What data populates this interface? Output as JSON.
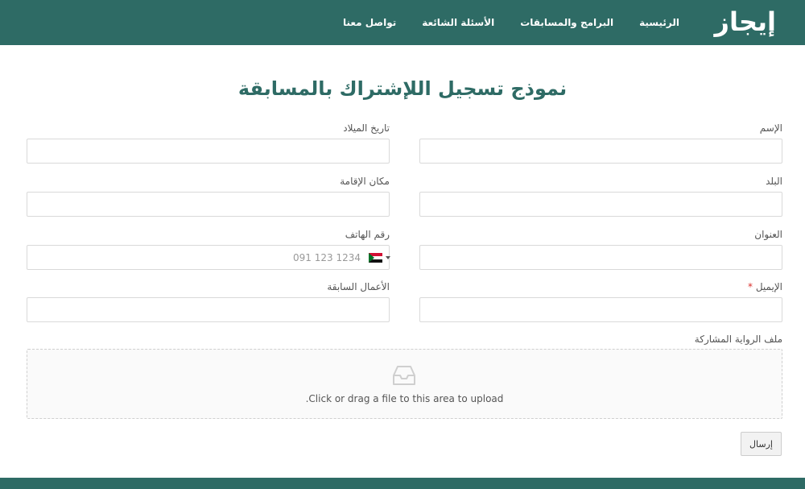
{
  "nav": {
    "logo": "إيجاز",
    "links": [
      "الرئيسية",
      "البرامج والمسابقات",
      "الأسئلة الشائعة",
      "تواصل معنا"
    ]
  },
  "form": {
    "title": "نموذج تسجيل اللإشتراك بالمسابقة",
    "fields": {
      "name": {
        "label": "الإسم",
        "value": ""
      },
      "birthdate": {
        "label": "تاريخ الميلاد",
        "value": ""
      },
      "country": {
        "label": "البلد",
        "value": ""
      },
      "residence": {
        "label": "مكان الإقامة",
        "value": ""
      },
      "address": {
        "label": "العنوان",
        "value": ""
      },
      "phone": {
        "label": "رقم الهاتف",
        "placeholder": "091 123 1234",
        "flag": "sudan-flag-icon"
      },
      "email": {
        "label": "الإيميل",
        "required_mark": "*",
        "value": ""
      },
      "previous_works": {
        "label": "الأعمال السابقة",
        "value": ""
      }
    },
    "upload": {
      "label": "ملف الرواية المشاركة",
      "icon": "inbox-icon",
      "text": "Click or drag a file to this area to upload."
    },
    "submit_label": "إرسال"
  },
  "colors": {
    "brand": "#2e6b65",
    "required": "#d9302c"
  }
}
